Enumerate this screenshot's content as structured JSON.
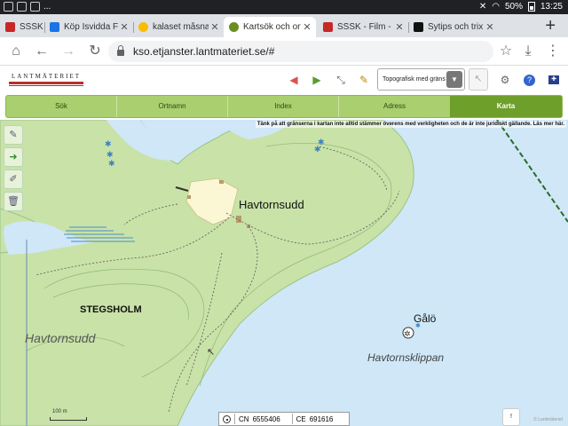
{
  "statusbar": {
    "overflow": "...",
    "battery": "50%",
    "time": "13:25"
  },
  "tabs": [
    {
      "label": "SSSK",
      "fav_color": "#c62828"
    },
    {
      "label": "Köp Isvidda Flex",
      "fav_color": "#1a73e8"
    },
    {
      "label": "kalaset måsnare",
      "fav_color": "#fbbc04"
    },
    {
      "label": "Kartsök och orte",
      "fav_color": "#6b8e23",
      "active": true
    },
    {
      "label": "SSSK - Film - Vis",
      "fav_color": "#c62828"
    },
    {
      "label": "Sytips och trix -",
      "fav_color": "#111111"
    }
  ],
  "toolbar": {
    "url": "kso.etjanster.lantmateriet.se/#",
    "home_icon": "home-icon",
    "back_icon": "back-arrow-icon",
    "forward_icon": "forward-arrow-icon",
    "reload_icon": "reload-icon"
  },
  "app": {
    "logo_text": "LANTMÄTERIET",
    "layer_select_value": "Topografisk med gräns",
    "accent": "#b5302c"
  },
  "nav": {
    "tabs": [
      "Sök",
      "Ortnamn",
      "Index",
      "Adress",
      "Karta"
    ],
    "active": "Karta"
  },
  "map": {
    "notice": "Tänk på att gränserna i kartan inte alltid stämmer överens med verkligheten och de är inte juridiskt gällande. Läs mer här.",
    "labels": {
      "havtornsudd": "Havtornsudd",
      "stegsholm": "STEGSHOLM",
      "havtornsudd_area": "Havtornsudd",
      "galo": "Gålö",
      "havtornsklippan": "Havtornsklippan"
    },
    "scale": "100 m",
    "credit": "© Lantmäteriet",
    "coords": {
      "cn_label": "CN",
      "cn_value": "6555406",
      "ce_label": "CE",
      "ce_value": "691616"
    },
    "info_button": "!",
    "colors": {
      "water": "#cfe7f6",
      "land": "#c9e2a8",
      "settlement": "#fbf6d3"
    }
  }
}
